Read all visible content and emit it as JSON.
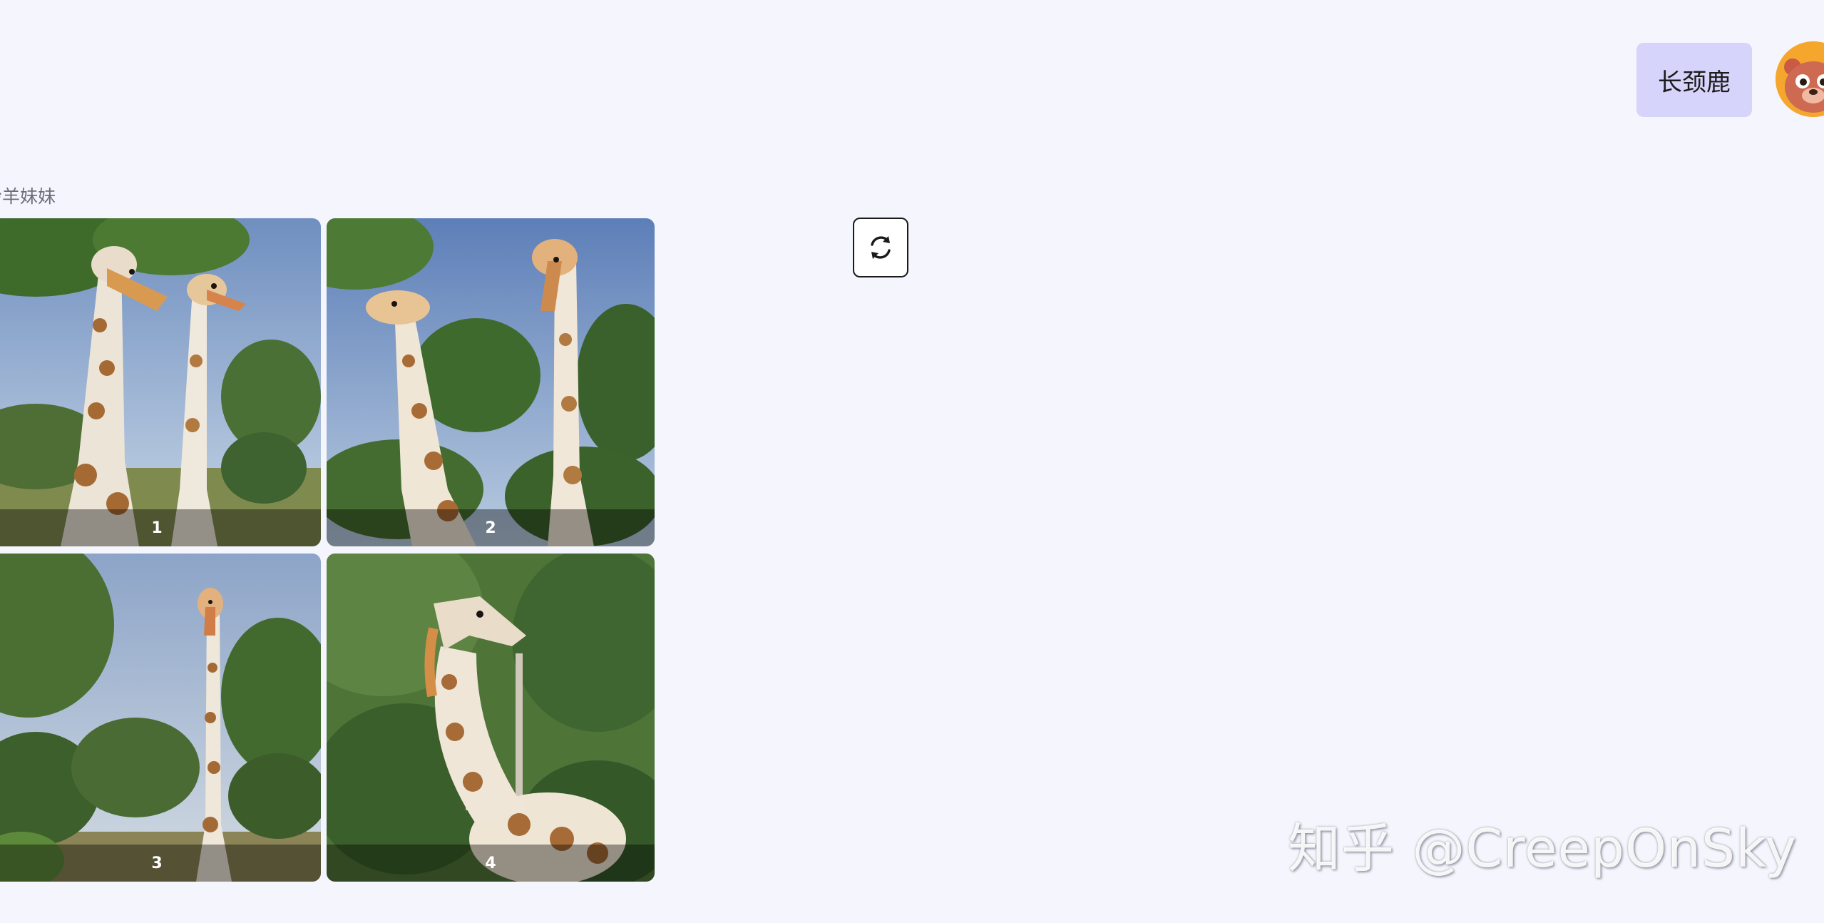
{
  "chat": {
    "user_message": "长颈鹿",
    "bot_name": "羚羊妹妹"
  },
  "results": {
    "images": [
      {
        "label": "1"
      },
      {
        "label": "2"
      },
      {
        "label": "3"
      },
      {
        "label": "4"
      }
    ]
  },
  "controls": {
    "refresh_icon": "refresh-icon"
  },
  "watermark": {
    "text": "知乎 @CreepOnSky"
  },
  "colors": {
    "background": "#f5f6fd",
    "user_bubble": "#d6d4fb",
    "avatar": "#f4a72c"
  }
}
